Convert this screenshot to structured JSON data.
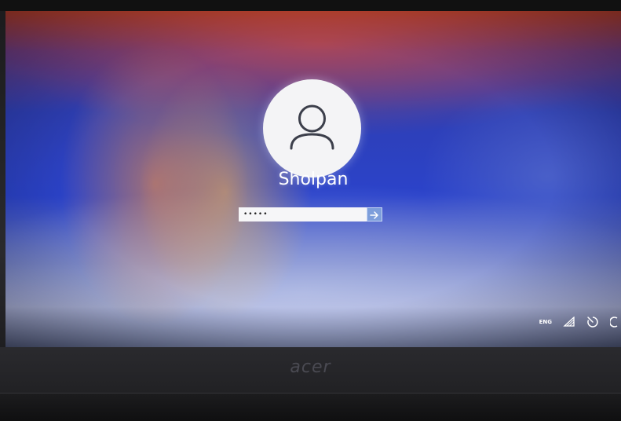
{
  "login": {
    "username": "Sholpan",
    "password_masked": "•••••",
    "submit_icon": "arrow-right-icon",
    "avatar_icon": "user-silhouette-icon"
  },
  "tray": {
    "language": "ENG",
    "icons": [
      "wifi-icon",
      "ease-of-access-icon",
      "power-icon"
    ]
  },
  "device": {
    "brand": "acer"
  },
  "colors": {
    "submit_button": "#7e9ed8",
    "avatar_background": "#f4f4f6",
    "text": "#ffffff"
  }
}
